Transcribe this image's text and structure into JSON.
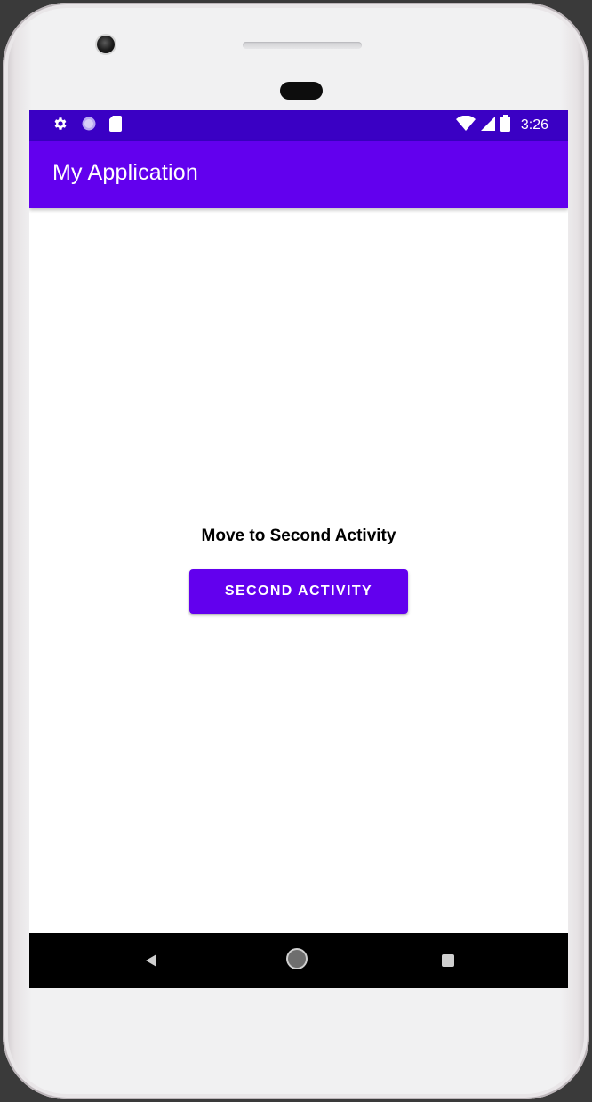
{
  "status_bar": {
    "time": "3:26",
    "left_icons": [
      "settings-icon",
      "circle-icon",
      "sd-card-icon"
    ],
    "right_icons": [
      "wifi-icon",
      "signal-icon",
      "battery-icon"
    ]
  },
  "app_bar": {
    "title": "My Application"
  },
  "main": {
    "label": "Move to Second Activity",
    "button_label": "SECOND ACTIVITY"
  },
  "nav_bar": {
    "icons": [
      "back-icon",
      "home-icon",
      "recents-icon"
    ]
  },
  "colors": {
    "primary": "#6200ee",
    "primary_dark": "#3a00c4",
    "nav_bar": "#000000",
    "background": "#ffffff"
  }
}
